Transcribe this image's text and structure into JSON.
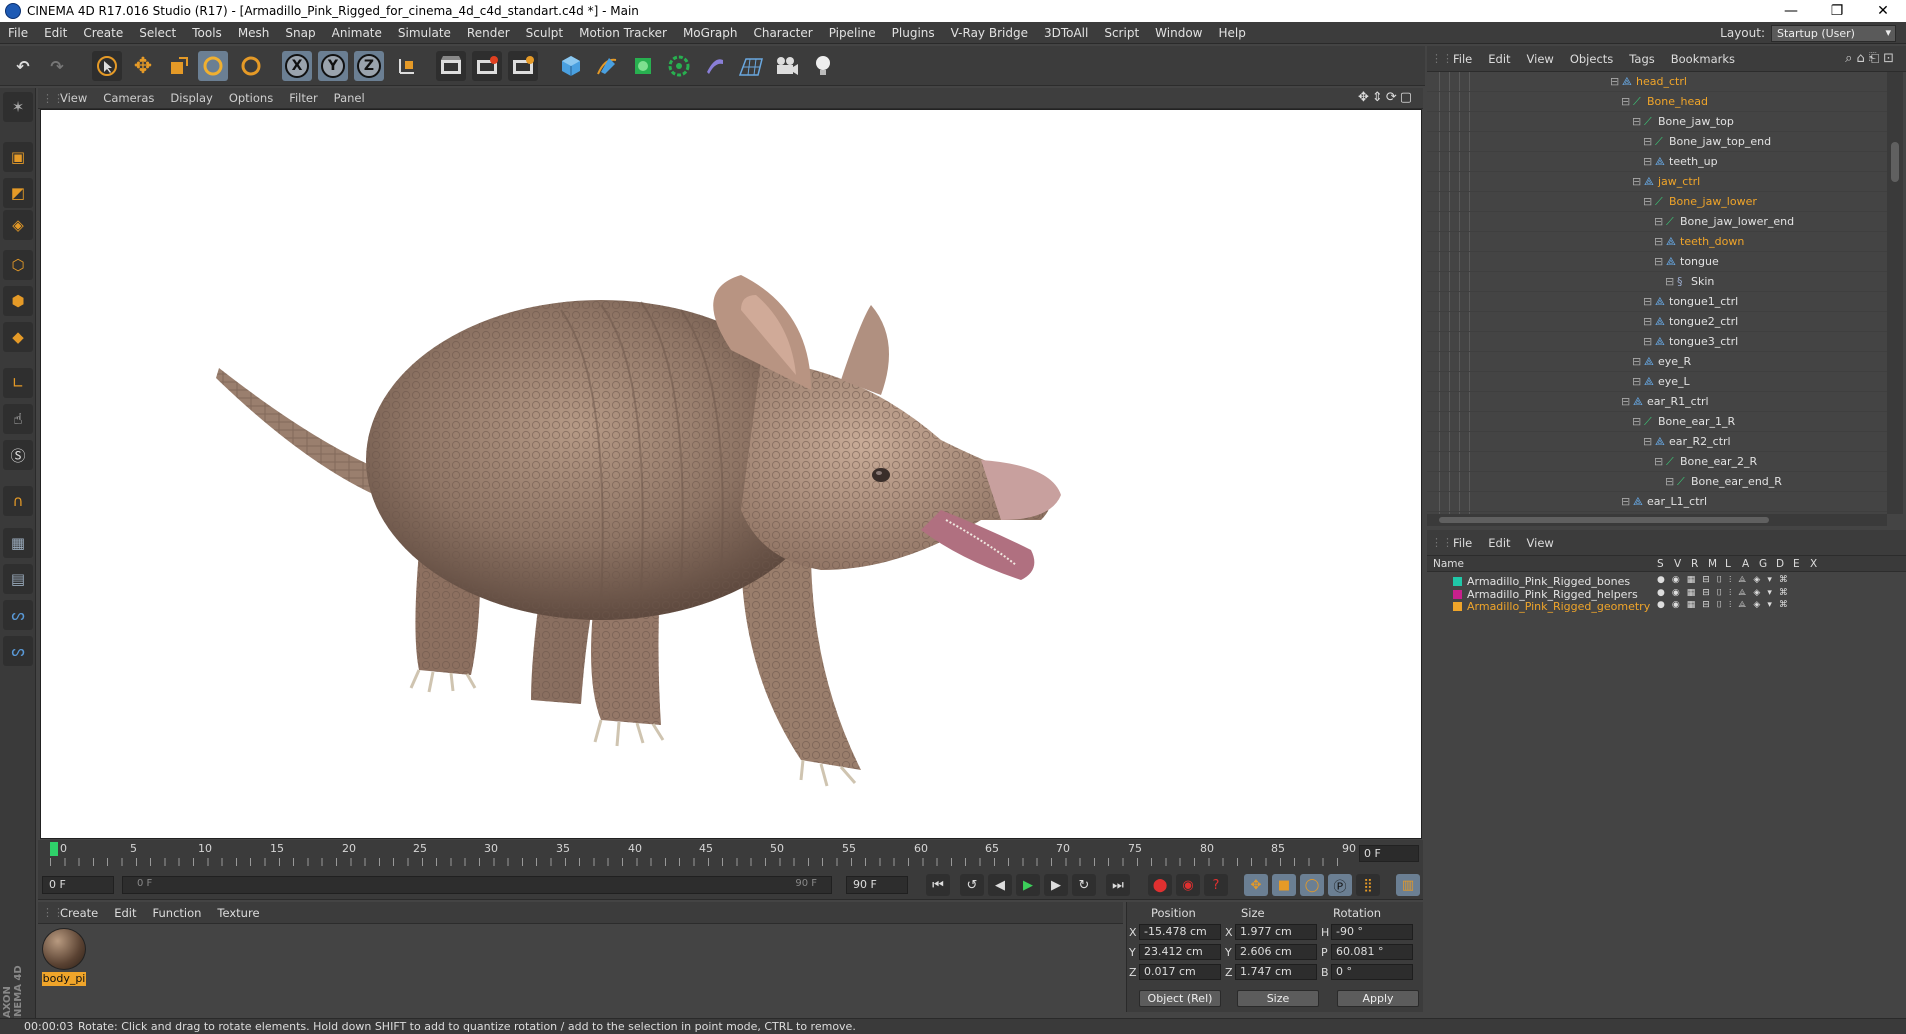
{
  "window": {
    "title": "CINEMA 4D R17.016 Studio (R17) - [Armadillo_Pink_Rigged_for_cinema_4d_c4d_standart.c4d *] - Main"
  },
  "menubar": {
    "items": [
      "File",
      "Edit",
      "Create",
      "Select",
      "Tools",
      "Mesh",
      "Snap",
      "Animate",
      "Simulate",
      "Render",
      "Sculpt",
      "Motion Tracker",
      "MoGraph",
      "Character",
      "Pipeline",
      "Plugins",
      "V-Ray Bridge",
      "3DToAll",
      "Script",
      "Window",
      "Help"
    ],
    "layout_label": "Layout:",
    "layout_value": "Startup (User)"
  },
  "toolbar": {
    "axis_x": "X",
    "axis_y": "Y",
    "axis_z": "Z"
  },
  "viewport": {
    "menu": [
      "View",
      "Cameras",
      "Display",
      "Options",
      "Filter",
      "Panel"
    ]
  },
  "timeline": {
    "ticks": [
      "0",
      "5",
      "10",
      "15",
      "20",
      "25",
      "30",
      "35",
      "40",
      "45",
      "50",
      "55",
      "60",
      "65",
      "70",
      "75",
      "80",
      "85",
      "90"
    ],
    "current_frame": "0 F"
  },
  "playback": {
    "start_field": "0 F",
    "range_start": "0 F",
    "range_end": "90 F",
    "end_field": "90 F"
  },
  "material_manager": {
    "menu": [
      "Create",
      "Edit",
      "Function",
      "Texture"
    ],
    "material_name": "body_pi"
  },
  "coordinates": {
    "headers": {
      "position": "Position",
      "size": "Size",
      "rotation": "Rotation"
    },
    "rows": [
      {
        "axis": "X",
        "pos": "-15.478 cm",
        "size_axis": "X",
        "size": "1.977 cm",
        "rot_axis": "H",
        "rot": "-90 °"
      },
      {
        "axis": "Y",
        "pos": "23.412 cm",
        "size_axis": "Y",
        "size": "2.606 cm",
        "rot_axis": "P",
        "rot": "60.081 °"
      },
      {
        "axis": "Z",
        "pos": "0.017 cm",
        "size_axis": "Z",
        "size": "1.747 cm",
        "rot_axis": "B",
        "rot": "0 °"
      }
    ],
    "mode_select": "Object (Rel)",
    "size_select": "Size",
    "apply_label": "Apply"
  },
  "object_manager": {
    "menu": [
      "File",
      "Edit",
      "View",
      "Objects",
      "Tags",
      "Bookmarks"
    ],
    "tree": [
      {
        "label": "head_ctrl",
        "depth": 0,
        "selected": true,
        "kind": "null"
      },
      {
        "label": "Bone_head",
        "depth": 1,
        "selected": true,
        "kind": "bone"
      },
      {
        "label": "Bone_jaw_top",
        "depth": 2,
        "selected": false,
        "kind": "bone"
      },
      {
        "label": "Bone_jaw_top_end",
        "depth": 3,
        "selected": false,
        "kind": "bone"
      },
      {
        "label": "teeth_up",
        "depth": 3,
        "selected": false,
        "kind": "null"
      },
      {
        "label": "jaw_ctrl",
        "depth": 2,
        "selected": true,
        "kind": "null"
      },
      {
        "label": "Bone_jaw_lower",
        "depth": 3,
        "selected": true,
        "kind": "bone"
      },
      {
        "label": "Bone_jaw_lower_end",
        "depth": 4,
        "selected": false,
        "kind": "bone"
      },
      {
        "label": "teeth_down",
        "depth": 4,
        "selected": true,
        "kind": "null"
      },
      {
        "label": "tongue",
        "depth": 4,
        "selected": false,
        "kind": "null"
      },
      {
        "label": "Skin",
        "depth": 5,
        "selected": false,
        "kind": "skin"
      },
      {
        "label": "tongue1_ctrl",
        "depth": 3,
        "selected": false,
        "kind": "null"
      },
      {
        "label": "tongue2_ctrl",
        "depth": 3,
        "selected": false,
        "kind": "null"
      },
      {
        "label": "tongue3_ctrl",
        "depth": 3,
        "selected": false,
        "kind": "null"
      },
      {
        "label": "eye_R",
        "depth": 2,
        "selected": false,
        "kind": "null"
      },
      {
        "label": "eye_L",
        "depth": 2,
        "selected": false,
        "kind": "null"
      },
      {
        "label": "ear_R1_ctrl",
        "depth": 1,
        "selected": false,
        "kind": "null"
      },
      {
        "label": "Bone_ear_1_R",
        "depth": 2,
        "selected": false,
        "kind": "bone"
      },
      {
        "label": "ear_R2_ctrl",
        "depth": 3,
        "selected": false,
        "kind": "null"
      },
      {
        "label": "Bone_ear_2_R",
        "depth": 4,
        "selected": false,
        "kind": "bone"
      },
      {
        "label": "Bone_ear_end_R",
        "depth": 5,
        "selected": false,
        "kind": "bone"
      },
      {
        "label": "ear_L1_ctrl",
        "depth": 1,
        "selected": false,
        "kind": "null"
      }
    ]
  },
  "layer_manager": {
    "menu": [
      "File",
      "Edit",
      "View"
    ],
    "header_name": "Name",
    "header_flags": [
      "S",
      "V",
      "R",
      "M",
      "L",
      "A",
      "G",
      "D",
      "E",
      "X"
    ],
    "layers": [
      {
        "name": "Armadillo_Pink_Rigged_bones",
        "color": "#1fc8a8",
        "selected": false
      },
      {
        "name": "Armadillo_Pink_Rigged_helpers",
        "color": "#c8208c",
        "selected": false
      },
      {
        "name": "Armadillo_Pink_Rigged_geometry",
        "color": "#f0a52a",
        "selected": true
      }
    ]
  },
  "status": {
    "time": "00:00:03",
    "message": "Rotate: Click and drag to rotate elements. Hold down SHIFT to add to quantize rotation / add to the selection in point mode, CTRL to remove."
  },
  "colors": {
    "accent": "#f0a52a",
    "panel": "#444444",
    "active_tool": "#6b7f93"
  }
}
